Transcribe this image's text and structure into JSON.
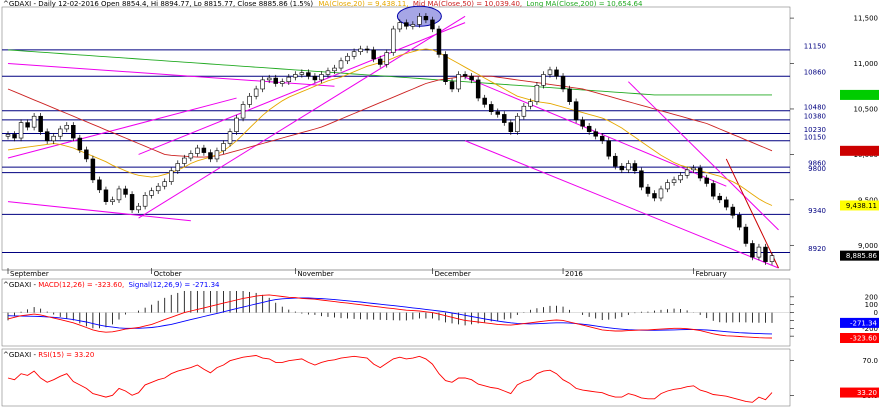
{
  "header": {
    "symbol": "^GDAXI",
    "sep": " - ",
    "desc": "Daily 12-02-2016 Open 8854.4, Hi 8894.77, Lo 8815.77, Close 8885.86 (1.5%)",
    "ma_label": "MA(Close,20) = 9,438.11,",
    "mid_label": "Mid MA(Close,50) = 10,039.40,",
    "long_label": "Long MA(Close,200) = 10,654.64"
  },
  "macd_header": {
    "symbol": "^GDAXI",
    "sep": " - ",
    "macd_label": "MACD(12,26) = -323.60,",
    "signal_label": "Signal(12,26,9) = -271.34"
  },
  "rsi_header": {
    "symbol": "^GDAXI",
    "sep": " - ",
    "rsi_label": "RSI(15) = 33.20"
  },
  "colors": {
    "candle_up": "#ffffff",
    "candle_down": "#000000",
    "ma20": "#e6a800",
    "ma50": "#cc2222",
    "ma200": "#22aa22",
    "channel": "#ee00ee",
    "horizontal": "#000080",
    "macd": "#ff0000",
    "signal": "#0000ff",
    "rsi": "#ff0000",
    "last_price_bg": "#000000",
    "ma20_bg": "#ffff00",
    "ma50_bg": "#cc0000",
    "ma200_bg": "#00cc00"
  },
  "chart_data": {
    "type": "candlestick",
    "ylim": [
      8750,
      11600
    ],
    "y_ticks": [
      "11,500",
      "11,000",
      "10,500",
      "10,000",
      "9,500",
      "9,000"
    ],
    "y_tick_values": [
      11500,
      11000,
      10500,
      10000,
      9500,
      9000
    ],
    "x_month_labels": [
      "September",
      "October",
      "November",
      "December",
      "2016",
      "February"
    ],
    "x_month_index": [
      0,
      22,
      44,
      65,
      85,
      105
    ],
    "horizontal_levels": [
      {
        "label": "11150",
        "value": 11150
      },
      {
        "label": "10860",
        "value": 10860
      },
      {
        "label": "10480",
        "value": 10480
      },
      {
        "label": "10380",
        "value": 10380
      },
      {
        "label": "10230",
        "value": 10230
      },
      {
        "label": "10150",
        "value": 10150
      },
      {
        "label": "9860",
        "value": 9860
      },
      {
        "label": "9800",
        "value": 9800
      },
      {
        "label": "9340",
        "value": 9340
      },
      {
        "label": "8920",
        "value": 8920
      }
    ],
    "last_price_label": "8,885.86",
    "last_price_value": 8885.86,
    "ma20_label": "9,438.11",
    "ma20_value": 9438.11,
    "ma50_value": 10039.4,
    "ma200_value": 10654.64,
    "close": [
      10220,
      10180,
      10350,
      10300,
      10420,
      10250,
      10150,
      10200,
      10280,
      10320,
      10180,
      10050,
      9950,
      9720,
      9610,
      9480,
      9500,
      9620,
      9560,
      9390,
      9430,
      9550,
      9600,
      9650,
      9700,
      9820,
      9900,
      9960,
      10010,
      10070,
      10020,
      9950,
      10040,
      10120,
      10250,
      10400,
      10550,
      10640,
      10720,
      10820,
      10840,
      10780,
      10800,
      10850,
      10880,
      10900,
      10860,
      10820,
      10880,
      10920,
      10950,
      11030,
      11080,
      11130,
      11160,
      11150,
      11050,
      10990,
      11120,
      11380,
      11450,
      11410,
      11430,
      11520,
      11480,
      11380,
      11100,
      10800,
      10720,
      10880,
      10860,
      10820,
      10620,
      10550,
      10470,
      10440,
      10350,
      10250,
      10420,
      10530,
      10580,
      10760,
      10880,
      10930,
      10860,
      10720,
      10580,
      10380,
      10310,
      10250,
      10200,
      10150,
      9980,
      9870,
      9830,
      9900,
      9820,
      9640,
      9570,
      9520,
      9620,
      9690,
      9720,
      9770,
      9830,
      9850,
      9740,
      9680,
      9540,
      9500,
      9420,
      9330,
      9200,
      9020,
      8870,
      8980,
      8820,
      8885.86
    ],
    "ma20": [
      10050,
      10060,
      10070,
      10080,
      10090,
      10100,
      10110,
      10120,
      10110,
      10090,
      10070,
      10040,
      10010,
      9980,
      9950,
      9920,
      9880,
      9850,
      9820,
      9790,
      9770,
      9760,
      9750,
      9760,
      9780,
      9800,
      9830,
      9860,
      9900,
      9930,
      9950,
      9970,
      10000,
      10040,
      10090,
      10150,
      10220,
      10290,
      10360,
      10430,
      10490,
      10540,
      10590,
      10630,
      10660,
      10690,
      10720,
      10750,
      10780,
      10810,
      10830,
      10850,
      10880,
      10910,
      10940,
      10970,
      10990,
      11010,
      11030,
      11060,
      11090,
      11110,
      11130,
      11150,
      11160,
      11150,
      11120,
      11080,
      11040,
      11000,
      10960,
      10920,
      10880,
      10840,
      10800,
      10760,
      10720,
      10680,
      10640,
      10620,
      10600,
      10580,
      10570,
      10560,
      10540,
      10520,
      10500,
      10480,
      10460,
      10440,
      10420,
      10400,
      10370,
      10330,
      10290,
      10240,
      10190,
      10140,
      10090,
      10040,
      9990,
      9950,
      9910,
      9880,
      9860,
      9840,
      9820,
      9800,
      9780,
      9760,
      9730,
      9700,
      9660,
      9610,
      9560,
      9510,
      9470,
      9438.11
    ],
    "ma50": [
      10720,
      10690,
      10660,
      10630,
      10600,
      10570,
      10540,
      10510,
      10480,
      10450,
      10420,
      10390,
      10360,
      10330,
      10300,
      10270,
      10240,
      10210,
      10180,
      10150,
      10120,
      10090,
      10060,
      10030,
      10000,
      9990,
      9985,
      9980,
      9975,
      9970,
      9970,
      9975,
      9985,
      10000,
      10020,
      10040,
      10060,
      10080,
      10100,
      10120,
      10140,
      10160,
      10180,
      10200,
      10220,
      10240,
      10260,
      10280,
      10300,
      10330,
      10360,
      10390,
      10420,
      10450,
      10480,
      10510,
      10540,
      10570,
      10600,
      10630,
      10660,
      10690,
      10720,
      10750,
      10780,
      10800,
      10820,
      10830,
      10840,
      10850,
      10860,
      10860,
      10860,
      10860,
      10860,
      10850,
      10840,
      10830,
      10820,
      10810,
      10800,
      10790,
      10780,
      10770,
      10760,
      10750,
      10740,
      10730,
      10720,
      10700,
      10680,
      10660,
      10640,
      10620,
      10600,
      10580,
      10560,
      10540,
      10520,
      10500,
      10480,
      10460,
      10440,
      10420,
      10400,
      10380,
      10360,
      10340,
      10310,
      10280,
      10250,
      10220,
      10190,
      10160,
      10130,
      10100,
      10070,
      10039.4
    ],
    "ma200": [
      11150,
      11145,
      11140,
      11135,
      11130,
      11125,
      11120,
      11115,
      11110,
      11105,
      11100,
      11095,
      11090,
      11085,
      11080,
      11075,
      11070,
      11065,
      11060,
      11055,
      11050,
      11045,
      11040,
      11035,
      11030,
      11025,
      11020,
      11015,
      11010,
      11005,
      11000,
      10995,
      10990,
      10985,
      10980,
      10975,
      10970,
      10965,
      10960,
      10955,
      10950,
      10945,
      10940,
      10935,
      10930,
      10925,
      10920,
      10915,
      10910,
      10905,
      10900,
      10895,
      10890,
      10885,
      10880,
      10875,
      10870,
      10865,
      10860,
      10855,
      10850,
      10845,
      10840,
      10835,
      10830,
      10825,
      10820,
      10815,
      10810,
      10805,
      10800,
      10795,
      10790,
      10785,
      10780,
      10775,
      10770,
      10765,
      10760,
      10755,
      10750,
      10745,
      10740,
      10735,
      10730,
      10725,
      10720,
      10715,
      10710,
      10705,
      10700,
      10695,
      10690,
      10685,
      10680,
      10675,
      10670,
      10665,
      10660,
      10655,
      10654.64,
      10654.64,
      10654.64,
      10654.64,
      10654.64,
      10654.64,
      10654.64,
      10654.64,
      10654.64,
      10654.64,
      10654.64,
      10654.64,
      10654.64,
      10654.64,
      10654.64,
      10654.64,
      10654.64,
      10654.64
    ],
    "macd_ylim": [
      -400,
      300
    ],
    "macd_ticks": [
      "200",
      "100",
      "0",
      "-100",
      "-200",
      "-300"
    ],
    "macd_tick_values": [
      200,
      100,
      0,
      -100,
      -200,
      -300
    ],
    "macd_last_label": "-323.60",
    "signal_last_label": "-271.34",
    "macd": [
      -80,
      -60,
      -40,
      -30,
      -20,
      -30,
      -50,
      -70,
      -90,
      -110,
      -130,
      -160,
      -190,
      -220,
      -240,
      -250,
      -245,
      -230,
      -210,
      -200,
      -190,
      -170,
      -150,
      -120,
      -90,
      -60,
      -30,
      0,
      20,
      40,
      60,
      80,
      100,
      120,
      140,
      160,
      180,
      195,
      210,
      220,
      225,
      215,
      205,
      195,
      190,
      180,
      175,
      170,
      160,
      150,
      140,
      130,
      120,
      110,
      100,
      90,
      80,
      70,
      60,
      50,
      40,
      30,
      25,
      20,
      10,
      0,
      -20,
      -40,
      -60,
      -80,
      -100,
      -110,
      -120,
      -130,
      -140,
      -150,
      -155,
      -160,
      -150,
      -140,
      -130,
      -120,
      -110,
      -100,
      -95,
      -100,
      -120,
      -140,
      -160,
      -180,
      -200,
      -220,
      -230,
      -235,
      -235,
      -230,
      -225,
      -220,
      -220,
      -215,
      -210,
      -205,
      -200,
      -200,
      -205,
      -215,
      -230,
      -250,
      -270,
      -285,
      -295,
      -300,
      -305,
      -310,
      -315,
      -320,
      -322,
      -323.6
    ],
    "signal": [
      -40,
      -42,
      -44,
      -46,
      -48,
      -50,
      -55,
      -60,
      -68,
      -78,
      -90,
      -105,
      -120,
      -140,
      -160,
      -175,
      -185,
      -195,
      -200,
      -200,
      -200,
      -195,
      -190,
      -180,
      -165,
      -150,
      -130,
      -110,
      -90,
      -70,
      -50,
      -30,
      -10,
      10,
      30,
      50,
      70,
      90,
      110,
      130,
      150,
      165,
      175,
      180,
      185,
      185,
      185,
      182,
      178,
      172,
      165,
      158,
      150,
      142,
      134,
      125,
      116,
      107,
      98,
      89,
      80,
      70,
      60,
      50,
      40,
      30,
      20,
      10,
      -5,
      -20,
      -35,
      -50,
      -65,
      -80,
      -95,
      -108,
      -120,
      -130,
      -138,
      -142,
      -144,
      -142,
      -138,
      -134,
      -130,
      -130,
      -134,
      -140,
      -148,
      -158,
      -170,
      -182,
      -194,
      -204,
      -212,
      -218,
      -222,
      -224,
      -225,
      -225,
      -224,
      -222,
      -220,
      -218,
      -216,
      -216,
      -218,
      -222,
      -228,
      -236,
      -244,
      -250,
      -256,
      -260,
      -264,
      -268,
      -270,
      -271.34
    ],
    "rsi_ylim": [
      20,
      80
    ],
    "rsi_ticks": [
      "70.0",
      "30.0"
    ],
    "rsi_tick_values": [
      70,
      30
    ],
    "rsi_last_label": "33.20",
    "rsi": [
      50,
      48,
      55,
      53,
      58,
      50,
      45,
      48,
      52,
      55,
      46,
      42,
      38,
      32,
      30,
      28,
      30,
      38,
      35,
      30,
      33,
      42,
      45,
      48,
      50,
      55,
      58,
      60,
      62,
      65,
      60,
      56,
      62,
      65,
      70,
      72,
      74,
      75,
      76,
      73,
      72,
      68,
      68,
      70,
      71,
      72,
      68,
      65,
      68,
      70,
      71,
      73,
      74,
      75,
      74,
      73,
      66,
      62,
      67,
      72,
      74,
      72,
      73,
      75,
      72,
      66,
      55,
      47,
      45,
      50,
      50,
      48,
      43,
      41,
      39,
      38,
      35,
      32,
      42,
      46,
      48,
      55,
      58,
      59,
      55,
      48,
      44,
      38,
      36,
      35,
      34,
      33,
      30,
      28,
      28,
      32,
      30,
      27,
      26,
      26,
      32,
      35,
      37,
      38,
      40,
      41,
      36,
      34,
      31,
      30,
      29,
      27,
      25,
      23,
      22,
      28,
      25,
      33.2
    ]
  }
}
